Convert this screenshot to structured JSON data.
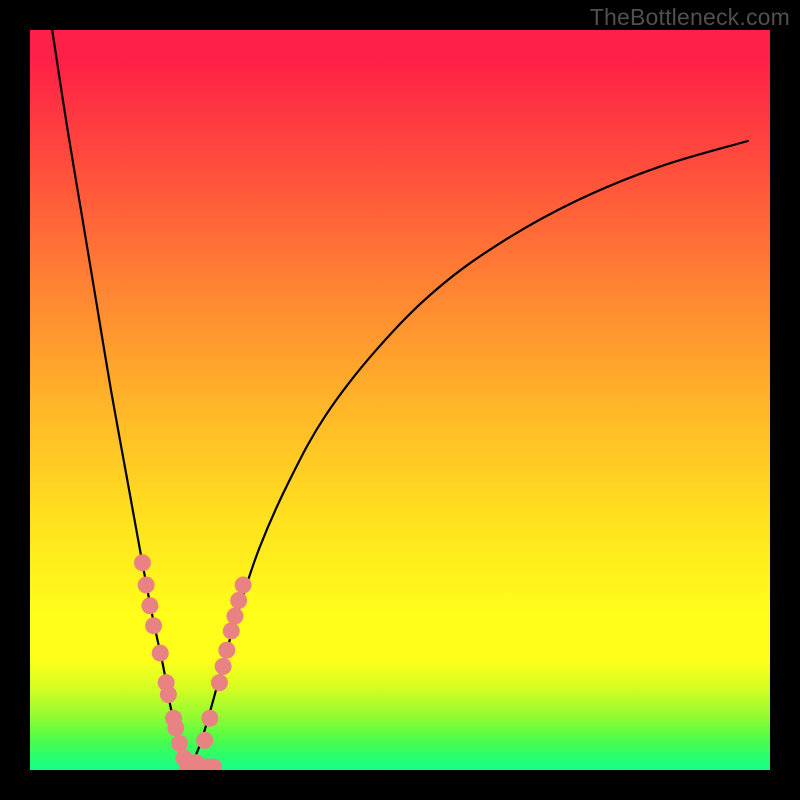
{
  "attribution": "TheBottleneck.com",
  "colors": {
    "frame": "#000000",
    "curve": "#000000",
    "dot": "#e98282",
    "gradient_stops": [
      "#fe2046",
      "#ff4c3d",
      "#ff8133",
      "#ffb329",
      "#ffe11f",
      "#fffe1a",
      "#d4fd22",
      "#8efb33",
      "#4bfc4b",
      "#2cfe6a",
      "#16ff8a"
    ]
  },
  "chart_data": {
    "type": "line",
    "title": "",
    "xlabel": "",
    "ylabel": "",
    "xlim": [
      0,
      100
    ],
    "ylim": [
      0,
      100
    ],
    "grid": false,
    "legend": false,
    "note": "Two branches of a V-shaped bottleneck curve. y≈100 means high bottleneck (top, red), y≈0 means no bottleneck (bottom, green). Values are read off the plot; no axes or numeric tick labels are shown in the source image — positions are estimated from pixel geometry.",
    "series": [
      {
        "name": "left-branch",
        "x": [
          3,
          5,
          7,
          9,
          11,
          13,
          15,
          16.5,
          18,
          19,
          20,
          20.8,
          21.5
        ],
        "y": [
          100,
          87,
          75,
          63,
          51,
          40,
          29,
          21,
          14,
          8.5,
          4,
          1.4,
          0
        ]
      },
      {
        "name": "right-branch",
        "x": [
          21.5,
          23,
          24.5,
          26,
          28,
          31,
          35,
          40,
          47,
          55,
          64,
          74,
          85,
          97
        ],
        "y": [
          0,
          3.5,
          8.5,
          14,
          21,
          30,
          39,
          48,
          57,
          65,
          71.5,
          77,
          81.5,
          85
        ]
      }
    ],
    "dots": {
      "name": "highlight-dots",
      "note": "Salmon markers clustered on the lower part of both branches and along the bottom.",
      "points": [
        {
          "x": 15.2,
          "y": 28.0
        },
        {
          "x": 15.7,
          "y": 25.0
        },
        {
          "x": 16.2,
          "y": 22.2
        },
        {
          "x": 16.7,
          "y": 19.5
        },
        {
          "x": 17.6,
          "y": 15.8
        },
        {
          "x": 18.4,
          "y": 11.8
        },
        {
          "x": 18.7,
          "y": 10.2
        },
        {
          "x": 19.4,
          "y": 7.0
        },
        {
          "x": 19.7,
          "y": 5.7
        },
        {
          "x": 20.2,
          "y": 3.6
        },
        {
          "x": 20.8,
          "y": 1.6
        },
        {
          "x": 21.3,
          "y": 0.4
        },
        {
          "x": 22.0,
          "y": 0.4
        },
        {
          "x": 22.8,
          "y": 0.4
        },
        {
          "x": 23.4,
          "y": 0.4
        },
        {
          "x": 24.1,
          "y": 0.4
        },
        {
          "x": 24.8,
          "y": 0.4
        },
        {
          "x": 21.6,
          "y": 1.0
        },
        {
          "x": 22.4,
          "y": 1.0
        },
        {
          "x": 23.6,
          "y": 4.0
        },
        {
          "x": 24.3,
          "y": 7.0
        },
        {
          "x": 25.6,
          "y": 11.8
        },
        {
          "x": 26.1,
          "y": 14.0
        },
        {
          "x": 26.6,
          "y": 16.2
        },
        {
          "x": 27.2,
          "y": 18.8
        },
        {
          "x": 27.7,
          "y": 20.8
        },
        {
          "x": 28.2,
          "y": 22.9
        },
        {
          "x": 28.8,
          "y": 25.0
        }
      ]
    }
  }
}
